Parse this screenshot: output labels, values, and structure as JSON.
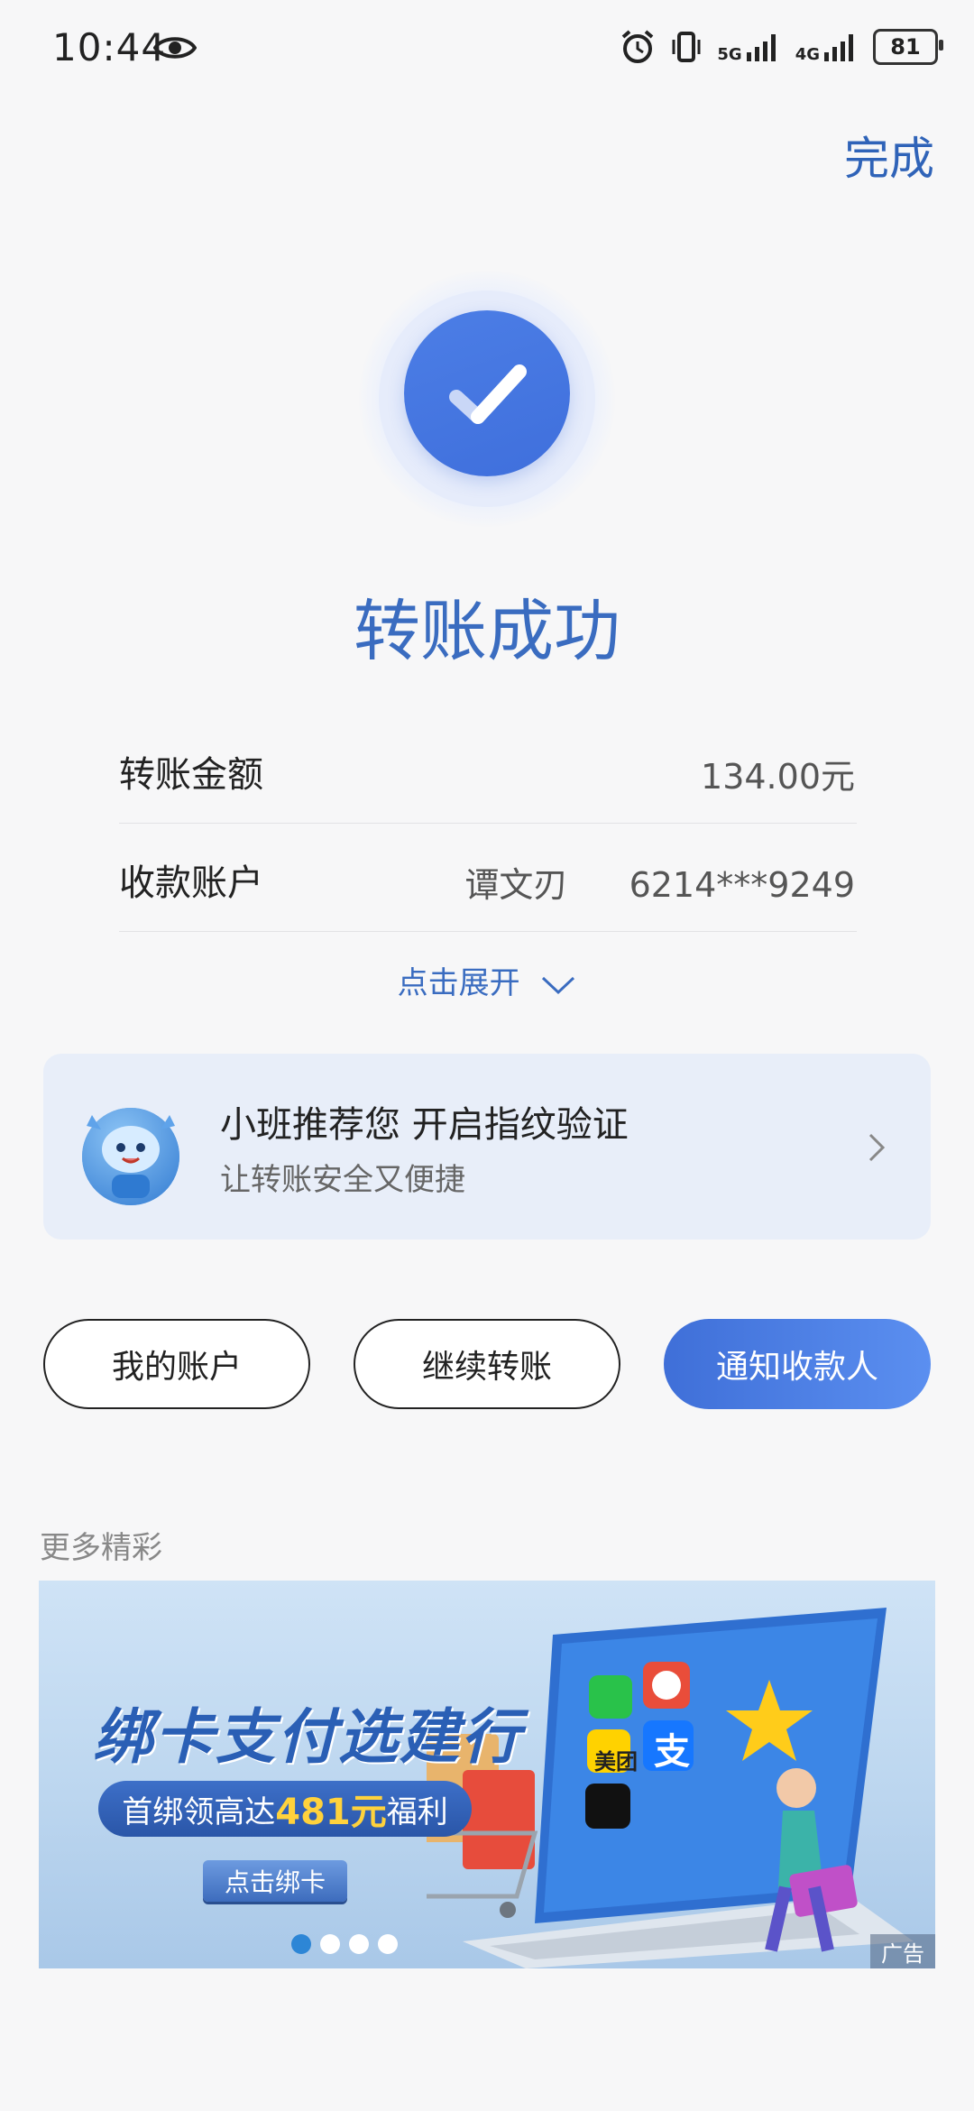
{
  "status_bar": {
    "time": "10:44",
    "net1": "5G",
    "net2": "4G",
    "battery": "81"
  },
  "header": {
    "done_label": "完成"
  },
  "result": {
    "title": "转账成功"
  },
  "details": {
    "amount_label": "转账金额",
    "amount_value": "134.00元",
    "account_label": "收款账户",
    "payee_name": "谭文刃",
    "payee_account": "6214***9249",
    "expand_label": "点击展开"
  },
  "promo_card": {
    "title": "小班推荐您 开启指纹验证",
    "subtitle": "让转账安全又便捷"
  },
  "actions": {
    "my_account": "我的账户",
    "continue_transfer": "继续转账",
    "notify_payee": "通知收款人"
  },
  "more": {
    "label": "更多精彩"
  },
  "banner": {
    "title": "绑卡支付选建行",
    "pill_prefix": "首绑领高达",
    "pill_amount": "481元",
    "pill_suffix": "福利",
    "button": "点击绑卡",
    "ad_tag": "广告",
    "app_tiles": [
      "美团",
      "支"
    ],
    "dots_total": 4,
    "dots_active": 1
  },
  "colors": {
    "accent": "#3a6cc0",
    "primary_button": "#4a7de6",
    "card_bg": "#e8eef9"
  }
}
